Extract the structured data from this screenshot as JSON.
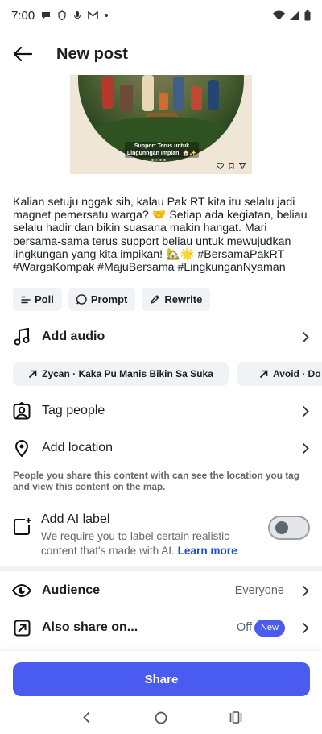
{
  "status_bar": {
    "time": "7:00"
  },
  "header": {
    "title": "New post"
  },
  "preview": {
    "caption": "Support Terus untuk Lingunngan Impian! 🏠✨"
  },
  "caption_text": "Kalian setuju nggak sih, kalau Pak RT kita itu selalu jadi magnet pemersatu warga? 🤝 Setiap ada kegiatan, beliau selalu hadir dan bikin suasana makin hangat. Mari bersama-sama terus support beliau untuk mewujudkan lingkungan yang kita impikan! 🏡🌟 #BersamaPakRT #WargaKompak #MajuBersama #LingkunganNyaman",
  "chips": [
    {
      "label": "Poll",
      "icon": "poll-icon"
    },
    {
      "label": "Prompt",
      "icon": "prompt-icon"
    },
    {
      "label": "Rewrite",
      "icon": "rewrite-icon"
    }
  ],
  "audio": {
    "label": "Add audio",
    "suggestions": [
      "Zycan · Kaka Pu Manis Bikin Sa Suka",
      "Avoid · Do"
    ]
  },
  "tag_people": {
    "label": "Tag people"
  },
  "add_location": {
    "label": "Add location",
    "hint": "People you share this content with can see the location you tag and view this content on the map."
  },
  "ai_label": {
    "title": "Add AI label",
    "desc": "We require you to label certain realistic content that's made with AI.",
    "link": "Learn more",
    "enabled": false
  },
  "audience": {
    "label": "Audience",
    "value": "Everyone"
  },
  "also_share": {
    "label": "Also share on...",
    "value": "Off",
    "badge": "New"
  },
  "share_button": {
    "label": "Share"
  },
  "colors": {
    "accent": "#4a5bf0",
    "link": "#1b4fd1"
  }
}
